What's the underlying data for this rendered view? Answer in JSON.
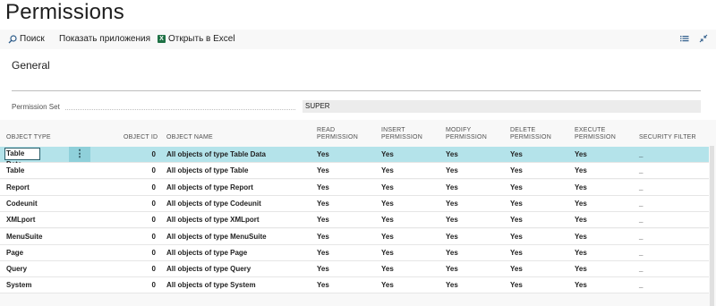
{
  "page": {
    "title": "Permissions"
  },
  "toolbar": {
    "search_label": "Поиск",
    "show_apps_label": "Показать приложения",
    "open_excel_label": "Открыть в Excel"
  },
  "general": {
    "section_label": "General",
    "permission_set_label": "Permission Set",
    "permission_set_value": "SUPER"
  },
  "columns": {
    "object_type": "OBJECT TYPE",
    "object_id": "OBJECT ID",
    "object_name": "OBJECT NAME",
    "read": [
      "READ",
      "PERMISSION"
    ],
    "insert": [
      "INSERT",
      "PERMISSION"
    ],
    "modify": [
      "MODIFY",
      "PERMISSION"
    ],
    "delete": [
      "DELETE",
      "PERMISSION"
    ],
    "execute": [
      "EXECUTE",
      "PERMISSION"
    ],
    "security_filter": "SECURITY FILTER"
  },
  "rows": [
    {
      "type": "Table Data",
      "id": "0",
      "name": "All objects of type Table Data",
      "read": "Yes",
      "insert": "Yes",
      "modify": "Yes",
      "delete": "Yes",
      "execute": "Yes",
      "filter": "_"
    },
    {
      "type": "Table",
      "id": "0",
      "name": "All objects of type Table",
      "read": "Yes",
      "insert": "Yes",
      "modify": "Yes",
      "delete": "Yes",
      "execute": "Yes",
      "filter": "_"
    },
    {
      "type": "Report",
      "id": "0",
      "name": "All objects of type Report",
      "read": "Yes",
      "insert": "Yes",
      "modify": "Yes",
      "delete": "Yes",
      "execute": "Yes",
      "filter": "_"
    },
    {
      "type": "Codeunit",
      "id": "0",
      "name": "All objects of type Codeunit",
      "read": "Yes",
      "insert": "Yes",
      "modify": "Yes",
      "delete": "Yes",
      "execute": "Yes",
      "filter": "_"
    },
    {
      "type": "XMLport",
      "id": "0",
      "name": "All objects of type XMLport",
      "read": "Yes",
      "insert": "Yes",
      "modify": "Yes",
      "delete": "Yes",
      "execute": "Yes",
      "filter": "_"
    },
    {
      "type": "MenuSuite",
      "id": "0",
      "name": "All objects of type MenuSuite",
      "read": "Yes",
      "insert": "Yes",
      "modify": "Yes",
      "delete": "Yes",
      "execute": "Yes",
      "filter": "_"
    },
    {
      "type": "Page",
      "id": "0",
      "name": "All objects of type Page",
      "read": "Yes",
      "insert": "Yes",
      "modify": "Yes",
      "delete": "Yes",
      "execute": "Yes",
      "filter": "_"
    },
    {
      "type": "Query",
      "id": "0",
      "name": "All objects of type Query",
      "read": "Yes",
      "insert": "Yes",
      "modify": "Yes",
      "delete": "Yes",
      "execute": "Yes",
      "filter": "_"
    },
    {
      "type": "System",
      "id": "0",
      "name": "All objects of type System",
      "read": "Yes",
      "insert": "Yes",
      "modify": "Yes",
      "delete": "Yes",
      "execute": "Yes",
      "filter": "_"
    }
  ],
  "selected_row": 0,
  "icons": {
    "search": "search-icon",
    "excel": "excel-icon",
    "list_view": "list-view-icon",
    "collapse": "collapse-icon",
    "row_actions": "row-actions-icon"
  }
}
